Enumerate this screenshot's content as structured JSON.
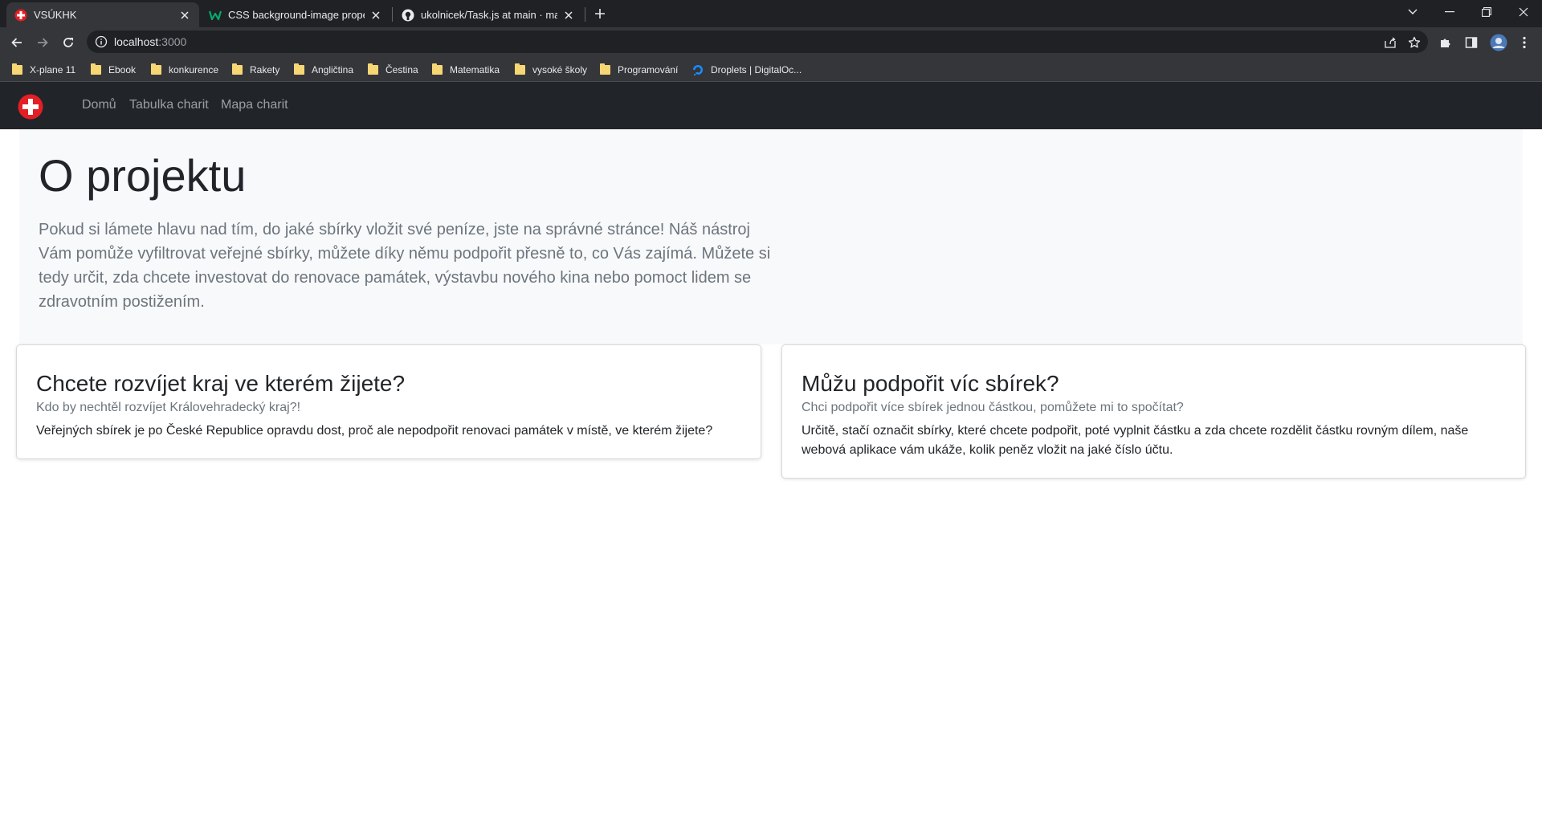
{
  "browser": {
    "tabs": [
      {
        "title": "VSÚKHK",
        "active": true
      },
      {
        "title": "CSS background-image property",
        "active": false
      },
      {
        "title": "ukolnicek/Task.js at main · matou",
        "active": false
      }
    ],
    "url": {
      "host": "localhost",
      "port": ":3000"
    },
    "bookmarks": [
      {
        "label": "X-plane 11",
        "icon": "folder-icon"
      },
      {
        "label": "Ebook",
        "icon": "folder-icon"
      },
      {
        "label": "konkurence",
        "icon": "folder-icon"
      },
      {
        "label": "Rakety",
        "icon": "folder-icon"
      },
      {
        "label": "Angličtina",
        "icon": "folder-icon"
      },
      {
        "label": "Čestina",
        "icon": "folder-icon"
      },
      {
        "label": "Matematika",
        "icon": "folder-icon"
      },
      {
        "label": "vysoké školy",
        "icon": "folder-icon"
      },
      {
        "label": "Programování",
        "icon": "folder-icon"
      },
      {
        "label": "Droplets | DigitalOc...",
        "icon": "digitalocean-icon"
      }
    ]
  },
  "site": {
    "brand_icon": "red-cross-logo-icon",
    "nav": [
      {
        "label": "Domů"
      },
      {
        "label": "Tabulka charit"
      },
      {
        "label": "Mapa charit"
      }
    ]
  },
  "hero": {
    "title": "O projektu",
    "text": "Pokud si lámete hlavu nad tím, do jaké sbírky vložit své peníze, jste na správné stránce! Náš nástroj Vám pomůže vyfiltrovat veřejné sbírky, můžete díky němu podpořit přesně to, co Vás zajímá. Můžete si tedy určit, zda chcete investovat do renovace památek, výstavbu nového kina nebo pomoct lidem se zdravotním postižením."
  },
  "cards": [
    {
      "title": "Chcete rozvíjet kraj ve kterém žijete?",
      "subtitle": "Kdo by nechtěl rozvíjet Královehradecký kraj?!",
      "text": "Veřejných sbírek je po České Republice opravdu dost, proč ale nepodpořit renovaci památek v místě, ve kterém žijete?"
    },
    {
      "title": "Můžu podpořit víc sbírek?",
      "subtitle": "Chci podpořit více sbírek jednou částkou, pomůžete mi to spočítat?",
      "text": "Určitě, stačí označit sbírky, které chcete podpořit, poté vyplnit částku a zda chcete rozdělit částku rovným dílem, naše webová aplikace vám ukáže, kolik peněz vložit na jaké číslo účtu."
    }
  ],
  "colors": {
    "navbar": "#212529",
    "hero_bg": "#f8f9fa",
    "brand_red": "#e31e24"
  }
}
